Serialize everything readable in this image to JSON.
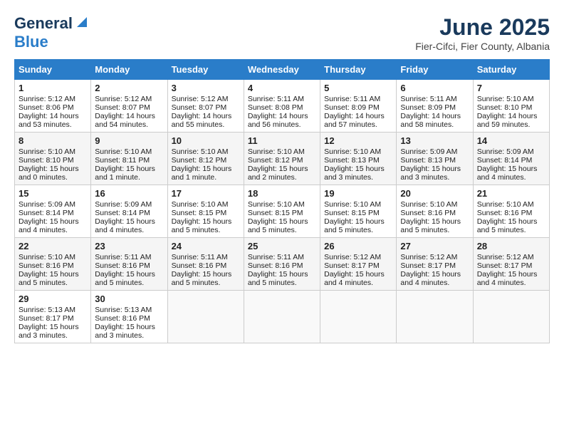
{
  "logo": {
    "general": "General",
    "blue": "Blue"
  },
  "title": "June 2025",
  "location": "Fier-Cifci, Fier County, Albania",
  "days": [
    "Sunday",
    "Monday",
    "Tuesday",
    "Wednesday",
    "Thursday",
    "Friday",
    "Saturday"
  ],
  "weeks": [
    [
      {
        "day": 1,
        "sunrise": "5:12 AM",
        "sunset": "8:06 PM",
        "daylight": "14 hours and 53 minutes."
      },
      {
        "day": 2,
        "sunrise": "5:12 AM",
        "sunset": "8:07 PM",
        "daylight": "14 hours and 54 minutes."
      },
      {
        "day": 3,
        "sunrise": "5:12 AM",
        "sunset": "8:07 PM",
        "daylight": "14 hours and 55 minutes."
      },
      {
        "day": 4,
        "sunrise": "5:11 AM",
        "sunset": "8:08 PM",
        "daylight": "14 hours and 56 minutes."
      },
      {
        "day": 5,
        "sunrise": "5:11 AM",
        "sunset": "8:09 PM",
        "daylight": "14 hours and 57 minutes."
      },
      {
        "day": 6,
        "sunrise": "5:11 AM",
        "sunset": "8:09 PM",
        "daylight": "14 hours and 58 minutes."
      },
      {
        "day": 7,
        "sunrise": "5:10 AM",
        "sunset": "8:10 PM",
        "daylight": "14 hours and 59 minutes."
      }
    ],
    [
      {
        "day": 8,
        "sunrise": "5:10 AM",
        "sunset": "8:10 PM",
        "daylight": "15 hours and 0 minutes."
      },
      {
        "day": 9,
        "sunrise": "5:10 AM",
        "sunset": "8:11 PM",
        "daylight": "15 hours and 1 minute."
      },
      {
        "day": 10,
        "sunrise": "5:10 AM",
        "sunset": "8:12 PM",
        "daylight": "15 hours and 1 minute."
      },
      {
        "day": 11,
        "sunrise": "5:10 AM",
        "sunset": "8:12 PM",
        "daylight": "15 hours and 2 minutes."
      },
      {
        "day": 12,
        "sunrise": "5:10 AM",
        "sunset": "8:13 PM",
        "daylight": "15 hours and 3 minutes."
      },
      {
        "day": 13,
        "sunrise": "5:09 AM",
        "sunset": "8:13 PM",
        "daylight": "15 hours and 3 minutes."
      },
      {
        "day": 14,
        "sunrise": "5:09 AM",
        "sunset": "8:14 PM",
        "daylight": "15 hours and 4 minutes."
      }
    ],
    [
      {
        "day": 15,
        "sunrise": "5:09 AM",
        "sunset": "8:14 PM",
        "daylight": "15 hours and 4 minutes."
      },
      {
        "day": 16,
        "sunrise": "5:09 AM",
        "sunset": "8:14 PM",
        "daylight": "15 hours and 4 minutes."
      },
      {
        "day": 17,
        "sunrise": "5:10 AM",
        "sunset": "8:15 PM",
        "daylight": "15 hours and 5 minutes."
      },
      {
        "day": 18,
        "sunrise": "5:10 AM",
        "sunset": "8:15 PM",
        "daylight": "15 hours and 5 minutes."
      },
      {
        "day": 19,
        "sunrise": "5:10 AM",
        "sunset": "8:15 PM",
        "daylight": "15 hours and 5 minutes."
      },
      {
        "day": 20,
        "sunrise": "5:10 AM",
        "sunset": "8:16 PM",
        "daylight": "15 hours and 5 minutes."
      },
      {
        "day": 21,
        "sunrise": "5:10 AM",
        "sunset": "8:16 PM",
        "daylight": "15 hours and 5 minutes."
      }
    ],
    [
      {
        "day": 22,
        "sunrise": "5:10 AM",
        "sunset": "8:16 PM",
        "daylight": "15 hours and 5 minutes."
      },
      {
        "day": 23,
        "sunrise": "5:11 AM",
        "sunset": "8:16 PM",
        "daylight": "15 hours and 5 minutes."
      },
      {
        "day": 24,
        "sunrise": "5:11 AM",
        "sunset": "8:16 PM",
        "daylight": "15 hours and 5 minutes."
      },
      {
        "day": 25,
        "sunrise": "5:11 AM",
        "sunset": "8:16 PM",
        "daylight": "15 hours and 5 minutes."
      },
      {
        "day": 26,
        "sunrise": "5:12 AM",
        "sunset": "8:17 PM",
        "daylight": "15 hours and 4 minutes."
      },
      {
        "day": 27,
        "sunrise": "5:12 AM",
        "sunset": "8:17 PM",
        "daylight": "15 hours and 4 minutes."
      },
      {
        "day": 28,
        "sunrise": "5:12 AM",
        "sunset": "8:17 PM",
        "daylight": "15 hours and 4 minutes."
      }
    ],
    [
      {
        "day": 29,
        "sunrise": "5:13 AM",
        "sunset": "8:17 PM",
        "daylight": "15 hours and 3 minutes."
      },
      {
        "day": 30,
        "sunrise": "5:13 AM",
        "sunset": "8:16 PM",
        "daylight": "15 hours and 3 minutes."
      },
      null,
      null,
      null,
      null,
      null
    ]
  ]
}
